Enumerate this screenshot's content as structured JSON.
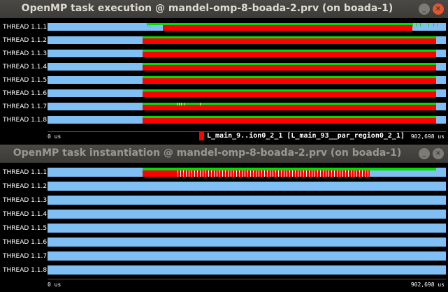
{
  "colors": {
    "idle": "#7fbff3",
    "running": "#ff0000",
    "created": "#00e000",
    "background": "#000000"
  },
  "window1": {
    "title": "OpenMP task execution @ mandel-omp-8-boada-2.prv (on boada-1)",
    "threads": [
      "THREAD 1.1.1",
      "THREAD 1.1.2",
      "THREAD 1.1.3",
      "THREAD 1.1.4",
      "THREAD 1.1.5",
      "THREAD 1.1.6",
      "THREAD 1.1.7",
      "THREAD 1.1.8"
    ],
    "axis_start": "0 us",
    "axis_end": "902,698 us",
    "legend_label": "L_main_9..ion0_2_1 [L_main_93__par_region0_2_1]"
  },
  "window2": {
    "title": "OpenMP task instantiation @ mandel-omp-8-boada-2.prv (on boada-1)",
    "threads": [
      "THREAD 1.1.1",
      "THREAD 1.1.2",
      "THREAD 1.1.3",
      "THREAD 1.1.4",
      "THREAD 1.1.5",
      "THREAD 1.1.6",
      "THREAD 1.1.7",
      "THREAD 1.1.8"
    ],
    "axis_start": "0 us",
    "axis_end": "902,698 us"
  },
  "title_buttons": {
    "minimize": "_",
    "close": "×"
  }
}
